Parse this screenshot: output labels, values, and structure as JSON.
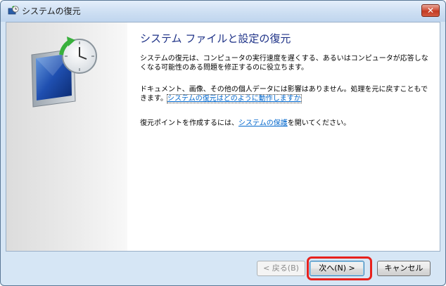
{
  "window": {
    "title": "システムの復元",
    "close_label": "✕"
  },
  "main": {
    "heading": "システム ファイルと設定の復元",
    "para1": "システムの復元は、コンピュータの実行速度を遅くする、あるいはコンピュータが応答しなくなる可能性のある問題を修正するのに役立ちます。",
    "para2_text": "ドキュメント、画像、その他の個人データには影響はありません。処理を元に戻すこともできます。",
    "para2_link": "システムの復元はどのように動作しますか",
    "para3_before": "復元ポイントを作成するには、",
    "para3_link": "システムの保護",
    "para3_after": "を開いてください。"
  },
  "buttons": {
    "back": "< 戻る(B)",
    "next": "次へ(N) >",
    "cancel": "キャンセル"
  },
  "colors": {
    "heading": "#1e3287",
    "link": "#0066cc",
    "highlight": "#e8211c"
  },
  "icons": {
    "title": "system-restore-icon",
    "side": "monitor-clock-icon"
  }
}
